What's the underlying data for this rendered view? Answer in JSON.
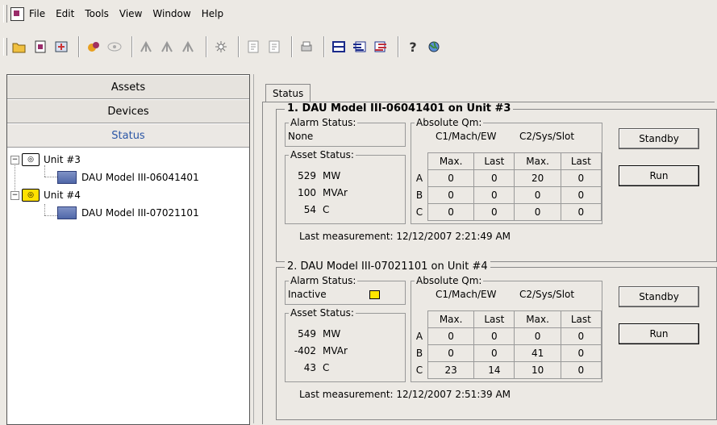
{
  "menubar": {
    "items": [
      "File",
      "Edit",
      "Tools",
      "View",
      "Window",
      "Help"
    ]
  },
  "toolbar": {
    "buttons": [
      "open-icon",
      "page-icon",
      "refresh-icon",
      "assets-icon",
      "link-icon",
      "trend1-icon",
      "trend2-icon",
      "trend3-icon",
      "alarm-icon",
      "report1-icon",
      "report2-icon",
      "print-icon",
      "list1-icon",
      "list2-icon",
      "list3-icon",
      "help-icon",
      "globe-icon"
    ]
  },
  "sidebar": {
    "nav": [
      "Assets",
      "Devices",
      "Status"
    ],
    "tree": [
      {
        "unit": "Unit #3",
        "device": "DAU Model III-06041401"
      },
      {
        "unit": "Unit #4",
        "device": "DAU Model III-07021101"
      }
    ]
  },
  "tabs": [
    "Status"
  ],
  "cards": [
    {
      "title": "1.   DAU Model III-06041401  on Unit #3",
      "alarm_label": "Alarm Status:",
      "alarm_value": "None",
      "asset_label": "Asset Status:",
      "asset": [
        {
          "value": "529",
          "unit": "MW"
        },
        {
          "value": "100",
          "unit": "MVAr"
        },
        {
          "value": "54",
          "unit": "C"
        }
      ],
      "qm_label": "Absolute Qm:",
      "qm_groups": [
        "C1/Mach/EW",
        "C2/Sys/Slot"
      ],
      "qm_cols": [
        "Max.",
        "Last",
        "Max.",
        "Last"
      ],
      "qm_rows": [
        {
          "label": "A",
          "values": [
            "0",
            "0",
            "20",
            "0"
          ]
        },
        {
          "label": "B",
          "values": [
            "0",
            "0",
            "0",
            "0"
          ]
        },
        {
          "label": "C",
          "values": [
            "0",
            "0",
            "0",
            "0"
          ]
        }
      ],
      "last_measurement": "Last measurement:  12/12/2007 2:21:49 AM",
      "standby_label": "Standby",
      "run_label": "Run"
    },
    {
      "title": "2.  DAU Model III-07021101 on Unit #4",
      "alarm_label": "Alarm Status:",
      "alarm_value": "Inactive",
      "alarm_color": "#ffe600",
      "asset_label": "Asset Status:",
      "asset": [
        {
          "value": "549",
          "unit": "MW"
        },
        {
          "value": "-402",
          "unit": "MVAr"
        },
        {
          "value": "43",
          "unit": "C"
        }
      ],
      "qm_label": "Absolute Qm:",
      "qm_groups": [
        "C1/Mach/EW",
        "C2/Sys/Slot"
      ],
      "qm_cols": [
        "Max.",
        "Last",
        "Max.",
        "Last"
      ],
      "qm_rows": [
        {
          "label": "A",
          "values": [
            "0",
            "0",
            "0",
            "0"
          ]
        },
        {
          "label": "B",
          "values": [
            "0",
            "0",
            "41",
            "0"
          ]
        },
        {
          "label": "C",
          "values": [
            "23",
            "14",
            "10",
            "0"
          ]
        }
      ],
      "last_measurement": "Last measurement:  12/12/2007 2:51:39 AM",
      "standby_label": "Standby",
      "run_label": "Run"
    }
  ]
}
